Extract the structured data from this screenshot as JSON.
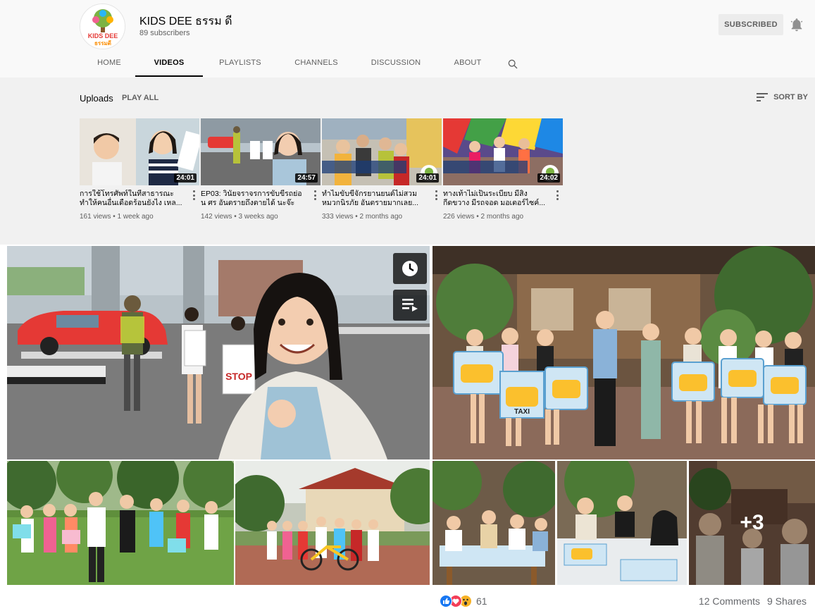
{
  "channel": {
    "name": "KIDS DEE ธรรม ดี",
    "subscribers": "89 subscribers",
    "subscribe_label": "SUBSCRIBED",
    "logo_text_top": "KIDS DEE",
    "logo_text_bottom": "ธรรมดี"
  },
  "tabs": [
    {
      "label": "HOME"
    },
    {
      "label": "VIDEOS"
    },
    {
      "label": "PLAYLISTS"
    },
    {
      "label": "CHANNELS"
    },
    {
      "label": "DISCUSSION"
    },
    {
      "label": "ABOUT"
    }
  ],
  "uploads": {
    "title": "Uploads",
    "play_all": "PLAY ALL",
    "sort_by": "SORT BY"
  },
  "videos": [
    {
      "title": "การใช้โทรศัพท์ในที่สาธารณะ ทำให้คนอื่นเดือดร้อนยังไง เหล...",
      "meta": "161 views • 1 week ago",
      "duration": "24:01"
    },
    {
      "title": "EP03: วินัยจราจรการขับขี่รถย่อน ศร อันตรายถึงตายได้ นะจ๊ะ",
      "meta": "142 views • 3 weeks ago",
      "duration": "24:57"
    },
    {
      "title": "ทำไมขับขี่จักรยานยนต์ไม่สวม หมวกนิรภัย อันตรายมากเลย...",
      "meta": "333 views • 2 months ago",
      "duration": "24:01"
    },
    {
      "title": "ทางเท้าไม่เป็นระเบียบ มีสิ่ง กีดขวาง มีรถจอด มอเตอร์ไซค์...",
      "meta": "226 views • 2 months ago",
      "duration": "24:02"
    }
  ],
  "collage": {
    "taxi_sign": "TAXI",
    "stop_sign": "STOP",
    "more_count": "+3"
  },
  "post": {
    "reaction_count": "61",
    "comments": "12 Comments",
    "shares": "9 Shares"
  },
  "colors": {
    "header_bg": "#f9f9f9",
    "uploads_bg": "#f1f1f1",
    "like_blue": "#1877f2",
    "love_red": "#f33e58",
    "wow_yellow": "#f7b125"
  }
}
